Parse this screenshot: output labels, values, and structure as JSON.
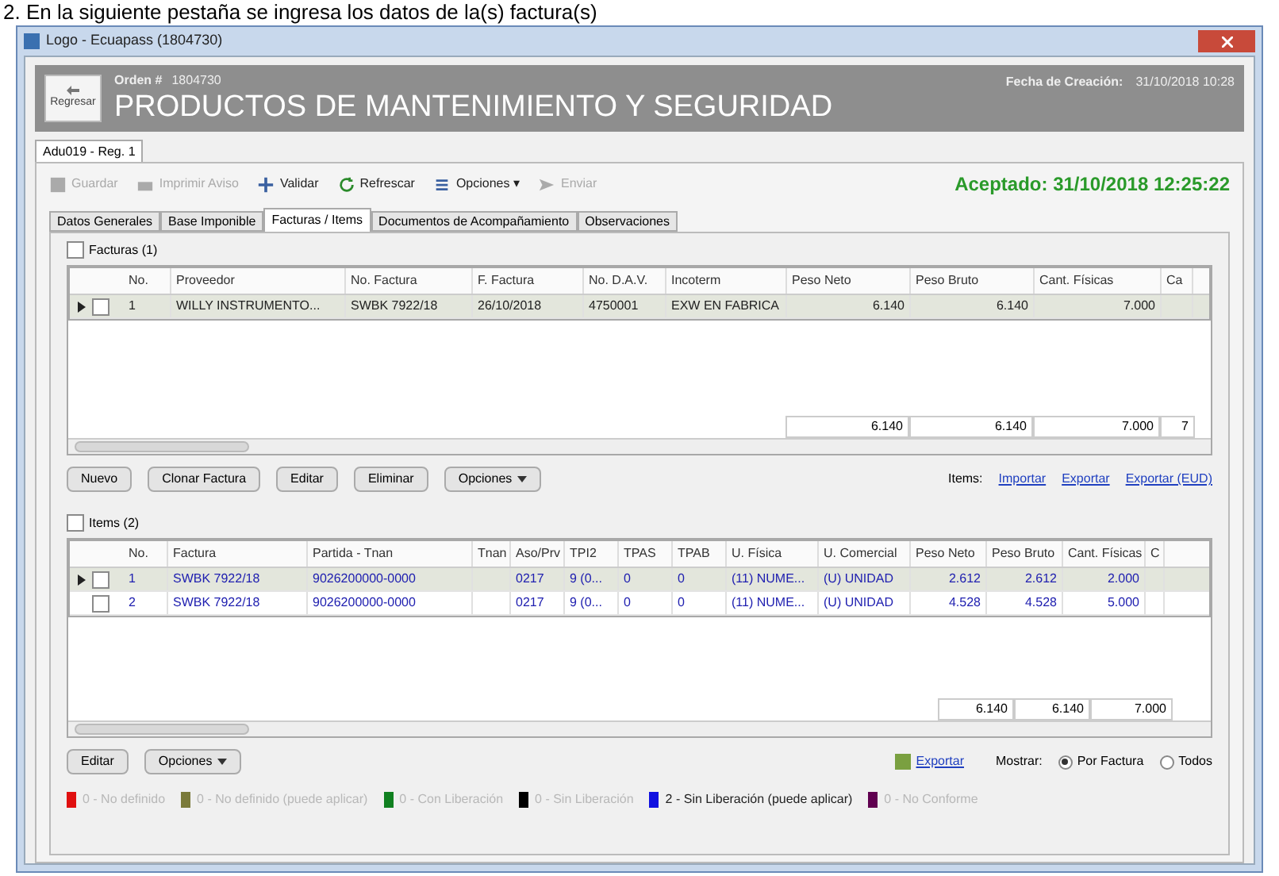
{
  "caption": "2. En la siguiente pestaña se ingresa los datos de la(s) factura(s)",
  "window": {
    "title": "Logo - Ecuapass (1804730)"
  },
  "header": {
    "back_button": "Regresar",
    "order_label": "Orden #",
    "order_number": "1804730",
    "title": "PRODUCTOS DE MANTENIMIENTO Y SEGURIDAD",
    "date_label": "Fecha de Creación:",
    "date_value": "31/10/2018 10:28"
  },
  "document_tab": "Adu019 - Reg. 1",
  "toolbar": [
    {
      "label": "Guardar",
      "disabled": true
    },
    {
      "label": "Imprimir Aviso",
      "disabled": true
    },
    {
      "label": "Validar",
      "disabled": false
    },
    {
      "label": "Refrescar",
      "disabled": false
    },
    {
      "label": "Opciones ▾",
      "disabled": false
    },
    {
      "label": "Enviar",
      "disabled": true
    }
  ],
  "status": "Aceptado: 31/10/2018 12:25:22",
  "tabs": [
    {
      "label": "Datos Generales",
      "selected": false
    },
    {
      "label": "Base Imponible",
      "selected": false
    },
    {
      "label": "Facturas / Items",
      "selected": true
    },
    {
      "label": "Documentos de Acompañamiento",
      "selected": false
    },
    {
      "label": "Observaciones",
      "selected": false
    }
  ],
  "invoices": {
    "label": "Facturas (1)",
    "checked": false,
    "columns": [
      "No.",
      "Proveedor",
      "No. Factura",
      "F. Factura",
      "No. D.A.V.",
      "Incoterm",
      "Peso Neto",
      "Peso Bruto",
      "Cant. Físicas",
      "Ca"
    ],
    "rows": [
      {
        "selected": true,
        "checked": false,
        "cells": [
          "1",
          "WILLY INSTRUMENTO...",
          "SWBK 7922/18",
          "26/10/2018",
          "4750001",
          "EXW EN FABRICA",
          "6.140",
          "6.140",
          "7.000",
          ""
        ]
      }
    ],
    "totals": [
      "6.140",
      "6.140",
      "7.000",
      "7"
    ]
  },
  "invoice_buttons": [
    "Nuevo",
    "Clonar Factura",
    "Editar",
    "Eliminar",
    "Opciones"
  ],
  "items_links": {
    "label": "Items:",
    "links": [
      "Importar",
      "Exportar",
      "Exportar (EUD)"
    ]
  },
  "items": {
    "label": "Items (2)",
    "checked": false,
    "columns": [
      "No.",
      "Factura",
      "Partida - Tnan",
      "Tnan",
      "Aso/Prv",
      "TPI2",
      "TPAS",
      "TPAB",
      "U. Física",
      "U. Comercial",
      "Peso Neto",
      "Peso Bruto",
      "Cant. Físicas",
      "C"
    ],
    "rows": [
      {
        "selected": true,
        "checked": false,
        "cells": [
          "1",
          "SWBK 7922/18",
          "9026200000-0000",
          "",
          "0217",
          "9 (0...",
          "0",
          "0",
          "(11) NUME...",
          "(U) UNIDAD",
          "2.612",
          "2.612",
          "2.000",
          ""
        ]
      },
      {
        "selected": false,
        "checked": false,
        "cells": [
          "2",
          "SWBK 7922/18",
          "9026200000-0000",
          "",
          "0217",
          "9 (0...",
          "0",
          "0",
          "(11) NUME...",
          "(U) UNIDAD",
          "4.528",
          "4.528",
          "5.000",
          ""
        ]
      }
    ],
    "totals": [
      "6.140",
      "6.140",
      "7.000"
    ]
  },
  "item_buttons": [
    "Editar",
    "Opciones"
  ],
  "export_link": "Exportar",
  "show": {
    "label": "Mostrar:",
    "options": [
      {
        "label": "Por Factura",
        "selected": true
      },
      {
        "label": "Todos",
        "selected": false
      }
    ]
  },
  "legend": [
    {
      "label": "0 - No definido",
      "color": "#e01010",
      "dimmed": true
    },
    {
      "label": "0 - No definido (puede aplicar)",
      "color": "#7a7a3a",
      "dimmed": true
    },
    {
      "label": "0 - Con Liberación",
      "color": "#108020",
      "dimmed": true
    },
    {
      "label": "0 - Sin Liberación",
      "color": "#000000",
      "dimmed": true
    },
    {
      "label": "2 - Sin Liberación (puede aplicar)",
      "color": "#1010e0",
      "dimmed": false
    },
    {
      "label": "0 - No Conforme",
      "color": "#600050",
      "dimmed": true
    }
  ]
}
